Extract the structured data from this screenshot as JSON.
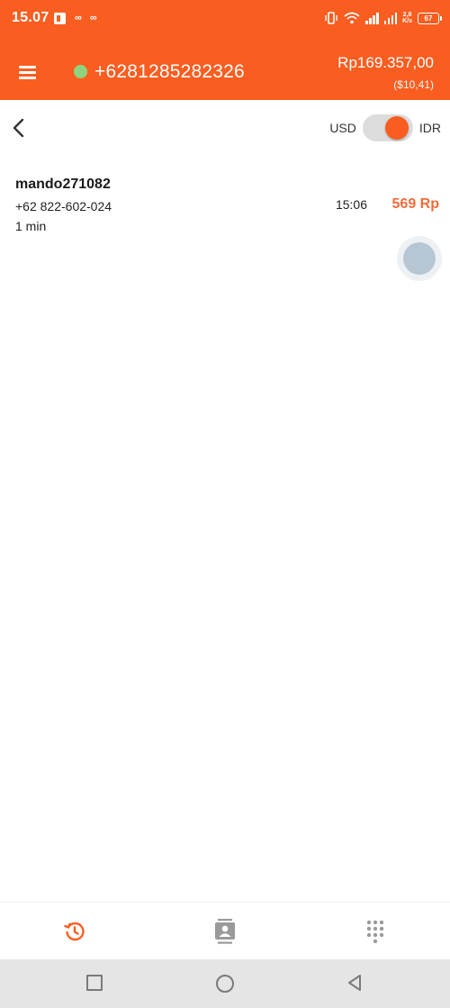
{
  "status_bar": {
    "time": "15.07",
    "left_icons": [
      "notification-box-icon",
      "infinity-icon",
      "infinity-icon"
    ],
    "right_icons": [
      "vibrate-icon",
      "wifi-icon",
      "signal-icon",
      "signal-icon",
      "network-speed-icon",
      "battery-icon"
    ],
    "network_speed": "2,8\nK/s",
    "battery_level": "67"
  },
  "app_bar": {
    "menu_icon": "hamburger-menu-icon",
    "online_status_color": "#8ed47f",
    "account_number": "+6281285282326",
    "balance_idr": "Rp169.357,00",
    "balance_usd": "($10,41)"
  },
  "toolbar": {
    "back_icon": "chevron-left-icon",
    "currency_left": "USD",
    "currency_right": "IDR",
    "selected_currency": "IDR"
  },
  "calls": [
    {
      "name": "mando271082",
      "number": "+62 822-602-024",
      "duration": "1 min",
      "time": "15:06",
      "cost": "569 Rp"
    }
  ],
  "bottom_nav": [
    {
      "name": "history",
      "icon": "history-icon",
      "active": true
    },
    {
      "name": "contacts",
      "icon": "contacts-icon",
      "active": false
    },
    {
      "name": "dialpad",
      "icon": "dialpad-icon",
      "active": false
    }
  ],
  "system_nav": [
    "recent-apps-icon",
    "home-icon",
    "back-triangle-icon"
  ],
  "colors": {
    "accent": "#fa5d20",
    "cost": "#f26b3a",
    "online": "#8ed47f",
    "inactive_icon": "#9a9a9a"
  }
}
